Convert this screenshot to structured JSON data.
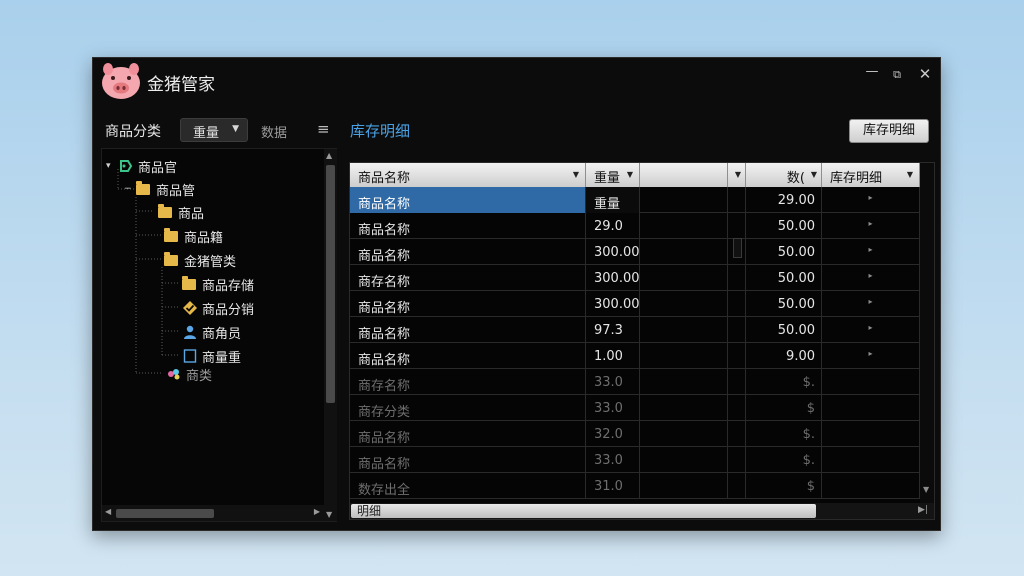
{
  "app": {
    "title": "金猪管家",
    "controls": {
      "minimize": "—",
      "maximize": "⧉",
      "close": "✕"
    }
  },
  "left_toolbar": {
    "label": "商品分类",
    "dropdown_value": "重量",
    "tab": "数据",
    "menu_icon": "≡"
  },
  "tree": {
    "nodes": [
      {
        "label": "商品官",
        "expander": "▾",
        "icon": "green-tag-icon"
      },
      {
        "label": "商品管",
        "expander": "−",
        "icon": "folder-icon"
      },
      {
        "label": "商品",
        "icon": "folder-icon"
      },
      {
        "label": "商品籍",
        "icon": "folder-icon"
      },
      {
        "label": "金猪管类",
        "icon": "folder-icon"
      },
      {
        "label": "商品存储",
        "icon": "folder-icon"
      },
      {
        "label": "商品分销",
        "icon": "check-tag-icon"
      },
      {
        "label": "商角员",
        "icon": "user-icon"
      },
      {
        "label": "商量重",
        "icon": "document-icon"
      },
      {
        "label": "商类",
        "icon": "colorful-icon"
      }
    ]
  },
  "main": {
    "section_title": "库存明细",
    "top_button": "库存明细",
    "grid": {
      "headers": [
        "商品名称",
        "重量",
        "",
        "",
        "数(",
        "库存明细"
      ],
      "rows": [
        [
          "商品名称",
          "重量",
          "",
          "",
          "29.00",
          "▸"
        ],
        [
          "商品名称",
          "29.0",
          "",
          "",
          "50.00",
          "▸"
        ],
        [
          "商品名称",
          "300.00",
          "",
          "",
          "50.00",
          "▸"
        ],
        [
          "商存名称",
          "300.00",
          "",
          "",
          "50.00",
          "▸"
        ],
        [
          "商品名称",
          "300.00",
          "",
          "",
          "50.00",
          "▸"
        ],
        [
          "商品名称",
          "97.3",
          "",
          "",
          "50.00",
          "▸"
        ],
        [
          "商品名称",
          "1.00",
          "",
          "",
          "9.00",
          "▸"
        ],
        [
          "商存名称",
          "33.0",
          "",
          "",
          "$.",
          ""
        ],
        [
          "商存分类",
          "33.0",
          "",
          "",
          "$",
          ""
        ],
        [
          "商品名称",
          "32.0",
          "",
          "",
          "$.",
          ""
        ],
        [
          "商品名称",
          "33.0",
          "",
          "",
          "$.",
          ""
        ],
        [
          "数存出全",
          "31.0",
          "",
          "",
          "$",
          ""
        ]
      ],
      "selected_row": 0,
      "faded_from": 7,
      "footer_label": "明细"
    }
  }
}
